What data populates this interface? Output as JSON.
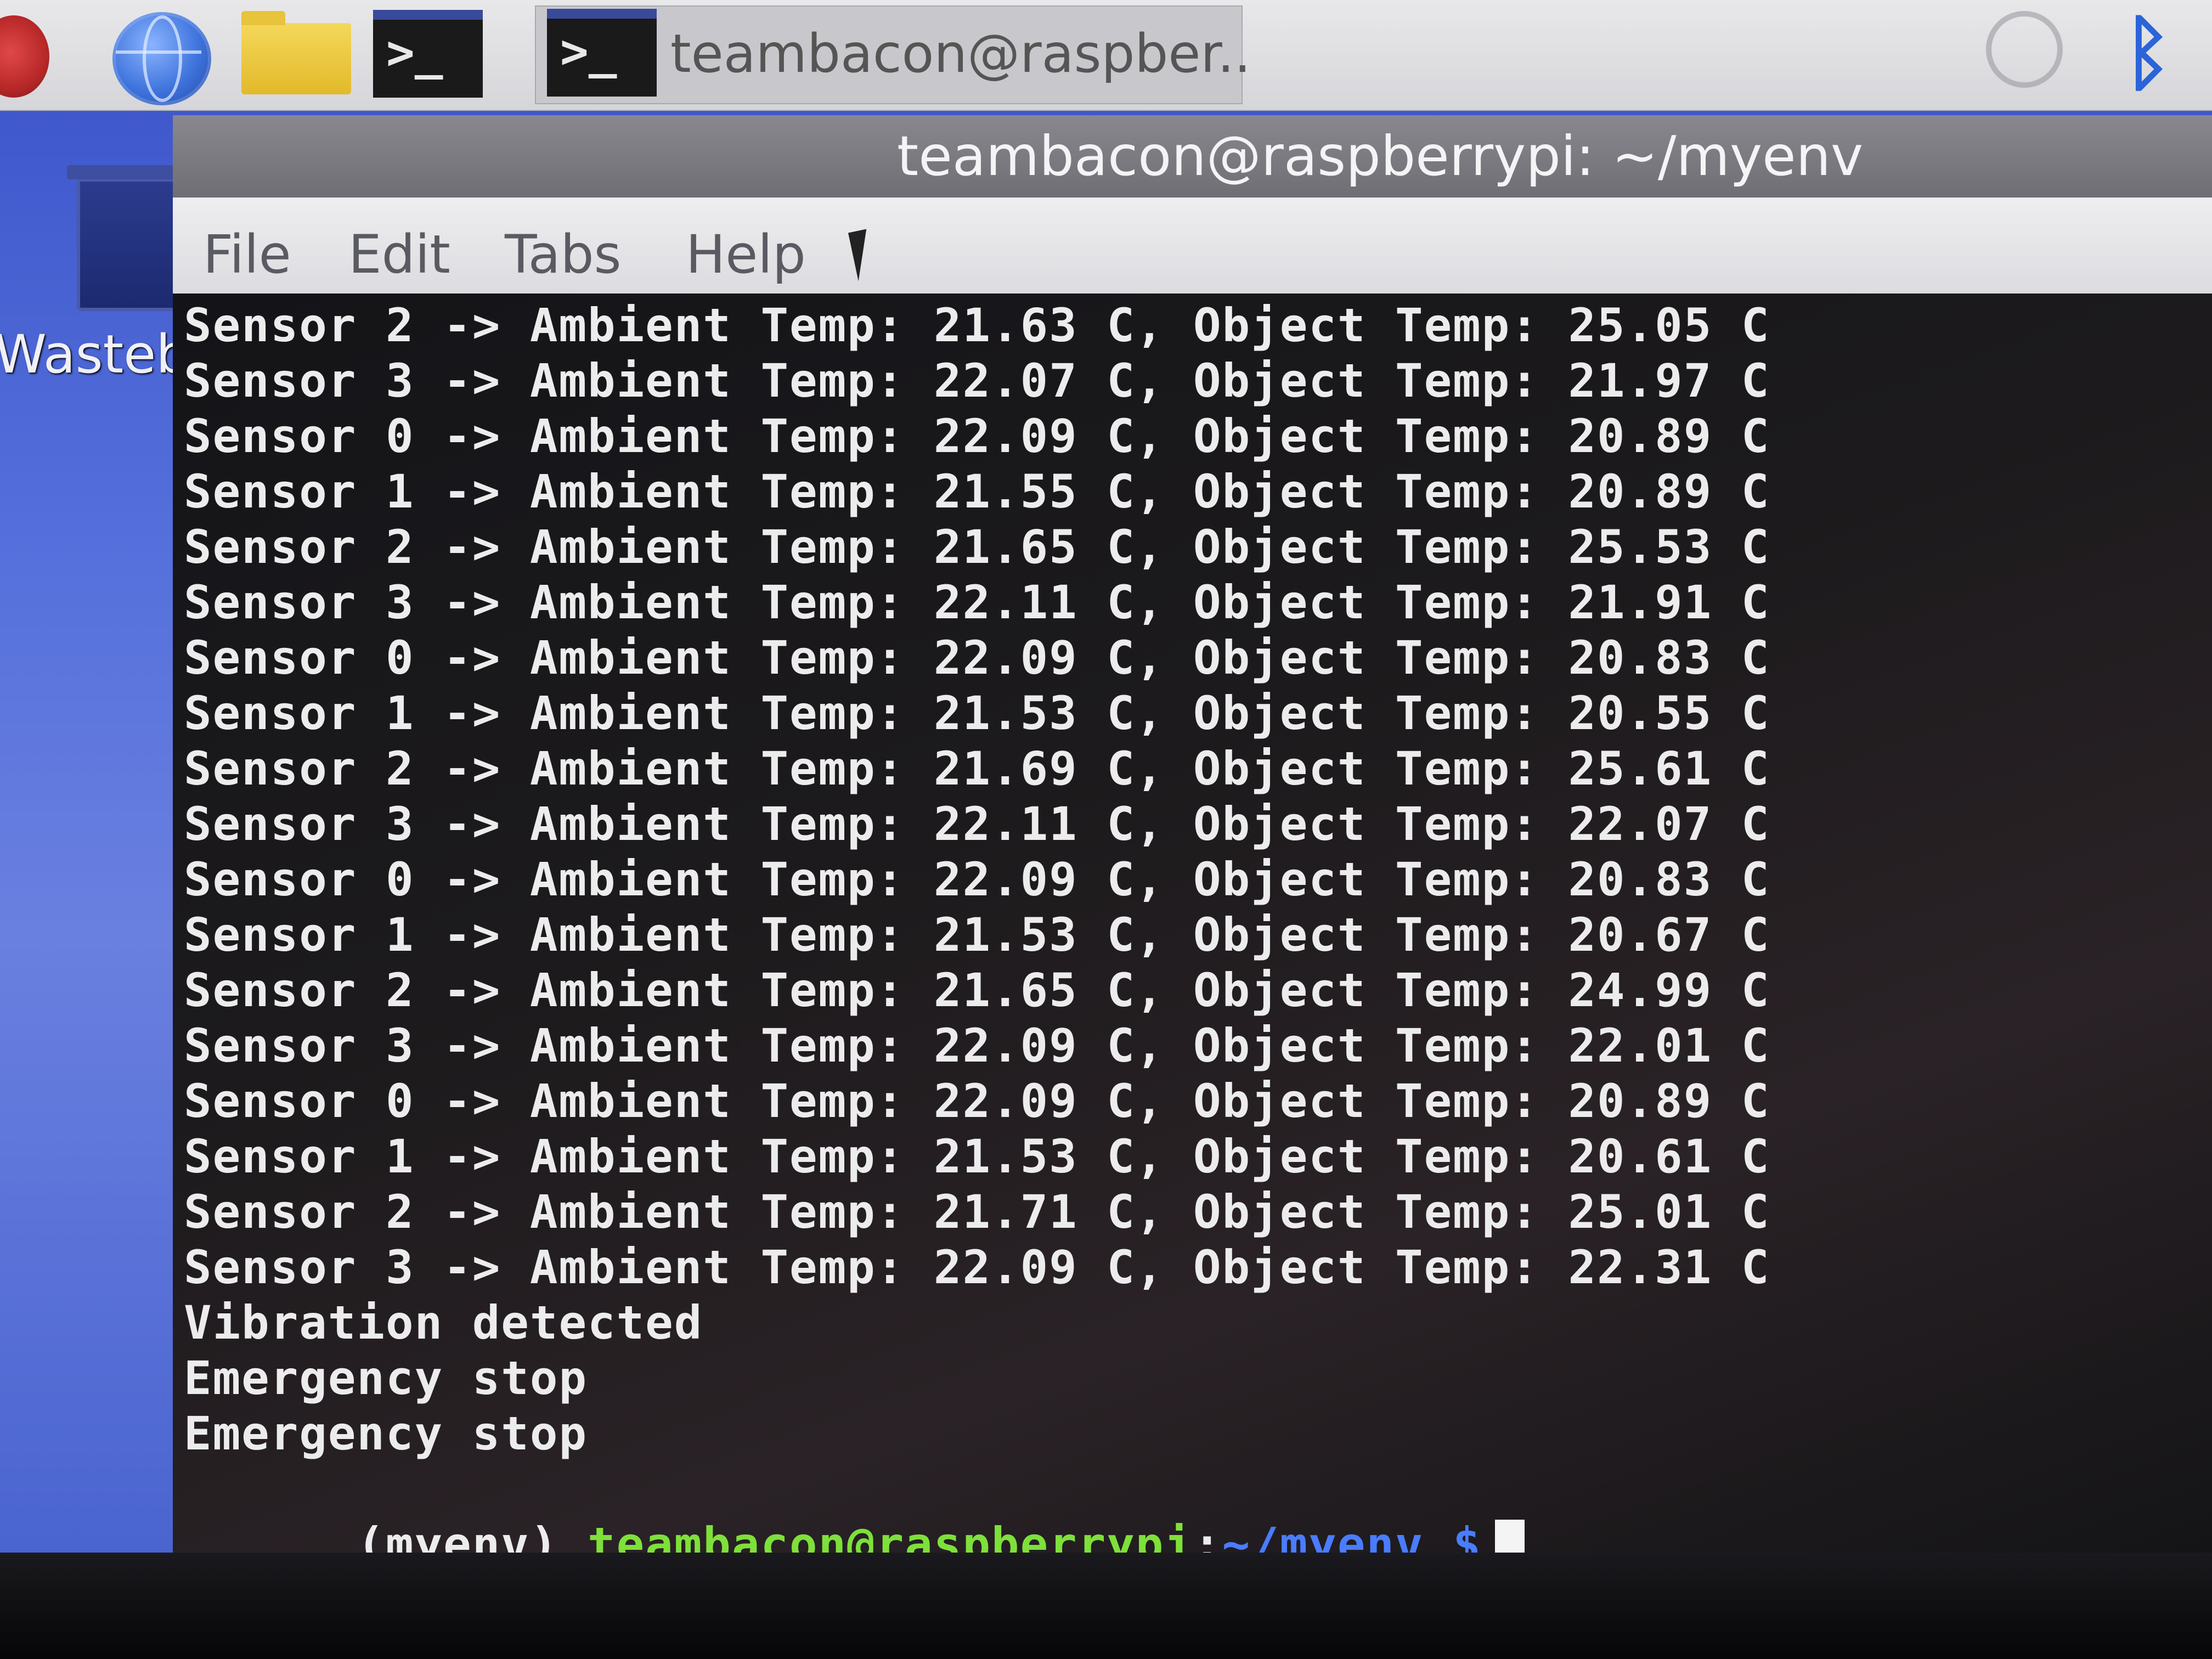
{
  "taskbar": {
    "menu_icon": "raspberry-menu-icon",
    "browser_icon": "globe-icon",
    "files_icon": "folder-icon",
    "terminal_icon_glyph": ">_",
    "task_label": "teambacon@raspber..",
    "network_icon": "network-icon",
    "bluetooth_glyph": "ᛒ"
  },
  "desktop": {
    "wastebasket_label": "Wasteb"
  },
  "terminal": {
    "title": "teambacon@raspberrypi: ~/myenv",
    "menu": {
      "file": "File",
      "edit": "Edit",
      "tabs": "Tabs",
      "help": "Help"
    },
    "lines": [
      "Sensor 2 -> Ambient Temp: 21.63 C, Object Temp: 25.05 C",
      "Sensor 3 -> Ambient Temp: 22.07 C, Object Temp: 21.97 C",
      "Sensor 0 -> Ambient Temp: 22.09 C, Object Temp: 20.89 C",
      "Sensor 1 -> Ambient Temp: 21.55 C, Object Temp: 20.89 C",
      "Sensor 2 -> Ambient Temp: 21.65 C, Object Temp: 25.53 C",
      "Sensor 3 -> Ambient Temp: 22.11 C, Object Temp: 21.91 C",
      "Sensor 0 -> Ambient Temp: 22.09 C, Object Temp: 20.83 C",
      "Sensor 1 -> Ambient Temp: 21.53 C, Object Temp: 20.55 C",
      "Sensor 2 -> Ambient Temp: 21.69 C, Object Temp: 25.61 C",
      "Sensor 3 -> Ambient Temp: 22.11 C, Object Temp: 22.07 C",
      "Sensor 0 -> Ambient Temp: 22.09 C, Object Temp: 20.83 C",
      "Sensor 1 -> Ambient Temp: 21.53 C, Object Temp: 20.67 C",
      "Sensor 2 -> Ambient Temp: 21.65 C, Object Temp: 24.99 C",
      "Sensor 3 -> Ambient Temp: 22.09 C, Object Temp: 22.01 C",
      "Sensor 0 -> Ambient Temp: 22.09 C, Object Temp: 20.89 C",
      "Sensor 1 -> Ambient Temp: 21.53 C, Object Temp: 20.61 C",
      "Sensor 2 -> Ambient Temp: 21.71 C, Object Temp: 25.01 C",
      "Sensor 3 -> Ambient Temp: 22.09 C, Object Temp: 22.31 C",
      "Vibration detected",
      "Emergency stop",
      "Emergency stop"
    ],
    "prompt": {
      "env": "(myenv) ",
      "user_host": "teambacon@raspberrypi",
      "colon": ":",
      "path": "~/myenv",
      "dollar": " $"
    }
  },
  "colors": {
    "prompt_user": "#7ee03a",
    "prompt_path": "#4a7cff",
    "terminal_text": "#ececec",
    "terminal_bg": "#141418",
    "wallpaper": "#4a64d0",
    "bluetooth": "#2b64d8"
  }
}
